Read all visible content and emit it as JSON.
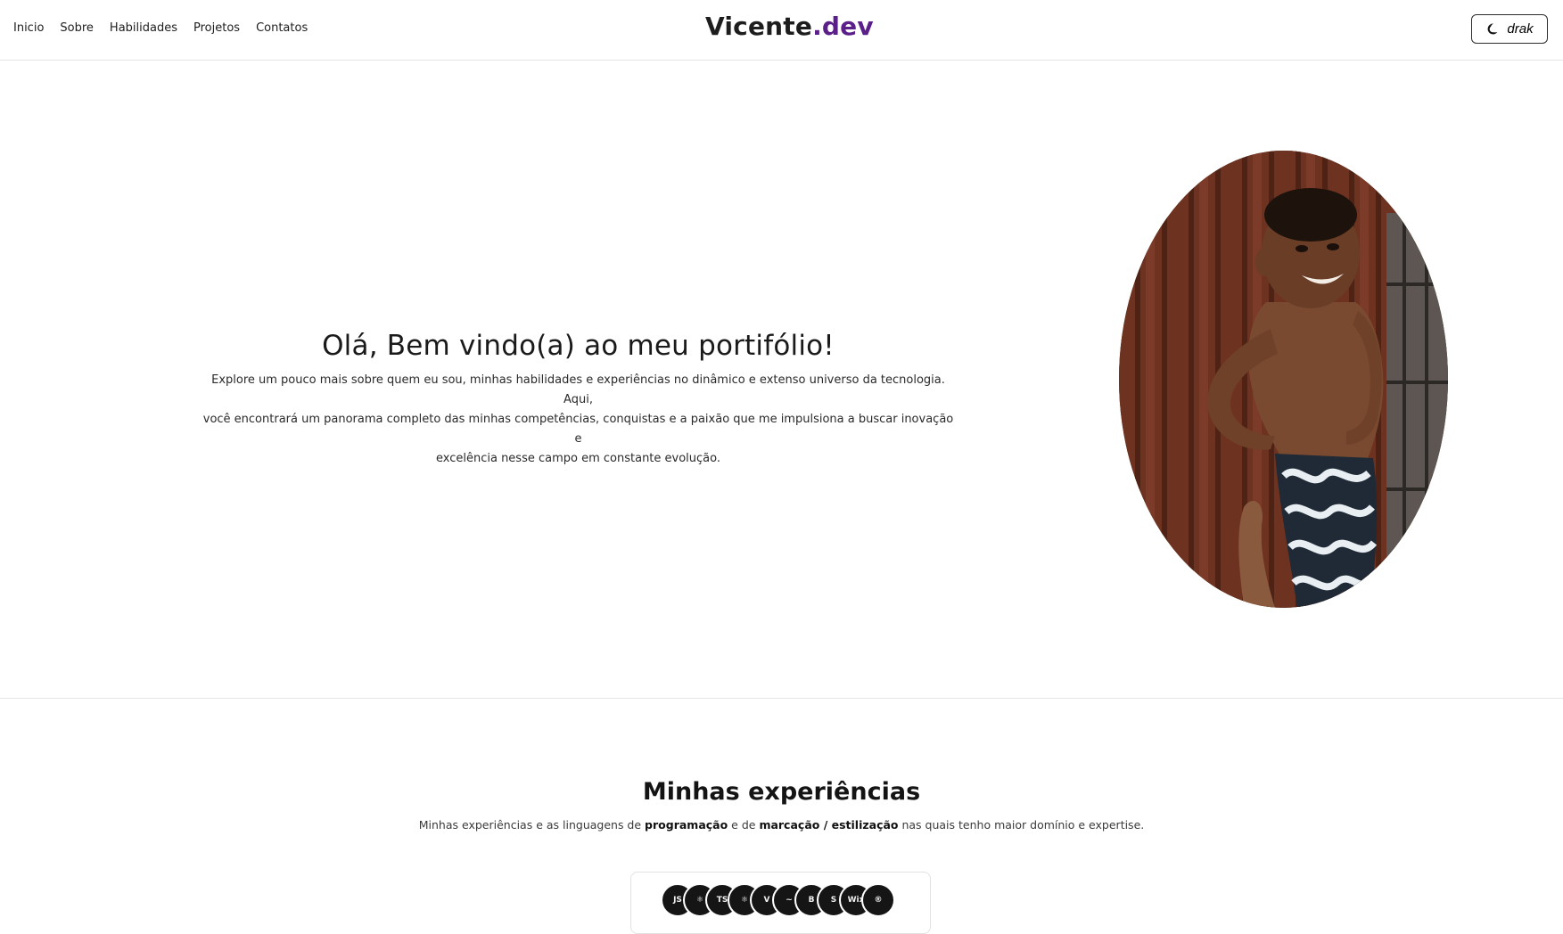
{
  "nav": {
    "items": [
      {
        "label": "Inicio"
      },
      {
        "label": "Sobre"
      },
      {
        "label": "Habilidades"
      },
      {
        "label": "Projetos"
      },
      {
        "label": "Contatos"
      }
    ]
  },
  "brand": {
    "name": "Vicente",
    "suffix": ".dev",
    "accent_color": "#5b1f8a"
  },
  "theme_toggle": {
    "label": "drak",
    "icon": "moon-icon"
  },
  "hero": {
    "title": "Olá, Bem vindo(a) ao meu portifólio!",
    "description_line1": "Explore um pouco mais sobre quem eu sou, minhas habilidades e experiências no dinâmico e extenso universo da tecnologia. Aqui,",
    "description_line2": "você encontrará um panorama completo das minhas competências, conquistas e a paixão que me impulsiona a buscar inovação e",
    "description_line3": "excelência nesse campo em constante evolução."
  },
  "experiences": {
    "title": "Minhas experiências",
    "subtitle_part1": "Minhas experiências e as linguagens de ",
    "subtitle_bold1": "programação",
    "subtitle_part2": " e de ",
    "subtitle_bold2": "marcação / estilização",
    "subtitle_part3": " nas quais tenho maior domínio e expertise.",
    "tech_icons": [
      {
        "name": "javascript-icon",
        "glyph": "JS"
      },
      {
        "name": "react-icon",
        "glyph": "⚛"
      },
      {
        "name": "typescript-icon",
        "glyph": "TS"
      },
      {
        "name": "react-native-icon",
        "glyph": "⚛"
      },
      {
        "name": "vite-icon",
        "glyph": "V"
      },
      {
        "name": "tailwind-icon",
        "glyph": "~"
      },
      {
        "name": "bootstrap-icon",
        "glyph": "B"
      },
      {
        "name": "styled-components-icon",
        "glyph": "S"
      },
      {
        "name": "wix-icon",
        "glyph": "Wix"
      },
      {
        "name": "registered-icon",
        "glyph": "®"
      }
    ]
  }
}
